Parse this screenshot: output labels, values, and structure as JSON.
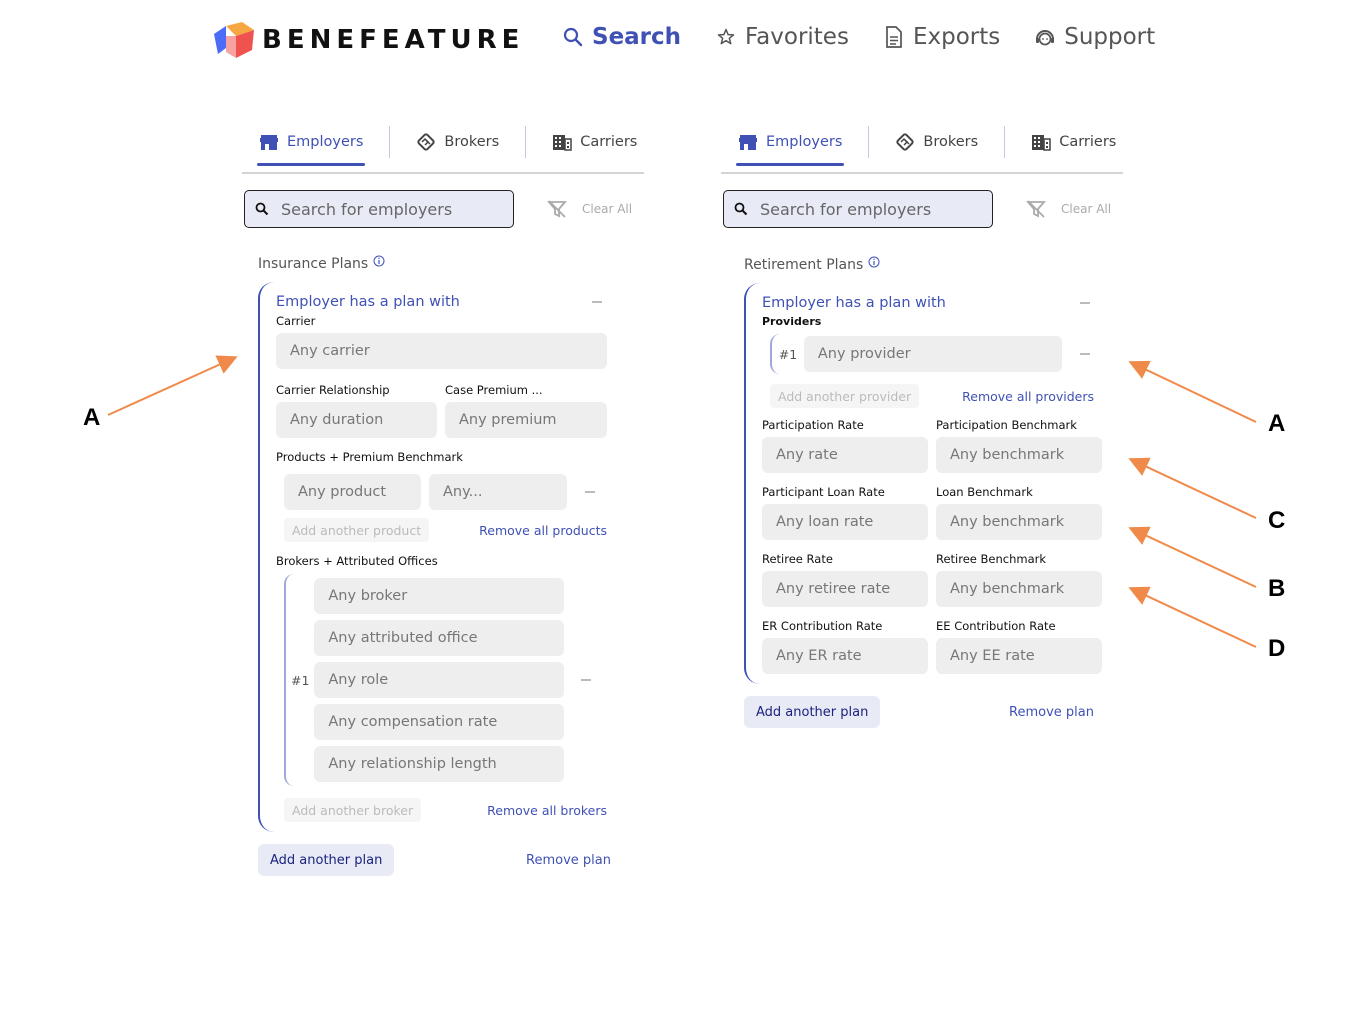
{
  "header": {
    "brand": "BENEFEATURE",
    "nav": [
      {
        "label": "Search",
        "icon": "search-icon",
        "active": true
      },
      {
        "label": "Favorites",
        "icon": "star-icon",
        "active": false
      },
      {
        "label": "Exports",
        "icon": "document-icon",
        "active": false
      },
      {
        "label": "Support",
        "icon": "support-agent-icon",
        "active": false
      }
    ]
  },
  "colors": {
    "accent": "#3f51b5",
    "field_bg": "#eeeeee",
    "search_bg": "#e8eaf6",
    "annotation_arrow": "#f08a4b"
  },
  "left_panel": {
    "tabs": [
      {
        "label": "Employers",
        "icon": "storefront-icon",
        "active": true
      },
      {
        "label": "Brokers",
        "icon": "handshake-icon",
        "active": false
      },
      {
        "label": "Carriers",
        "icon": "building-icon",
        "active": false
      }
    ],
    "search_placeholder": "Search for employers",
    "clear_all": "Clear All",
    "section_title": "Insurance Plans",
    "plan": {
      "title": "Employer has a plan with",
      "carrier_label": "Carrier",
      "carrier_placeholder": "Any carrier",
      "carrier_relationship_label": "Carrier Relationship",
      "carrier_relationship_placeholder": "Any duration",
      "case_premium_label": "Case Premium ...",
      "case_premium_placeholder": "Any premium",
      "products_label": "Products + Premium Benchmark",
      "product_placeholder": "Any product",
      "benchmark_placeholder": "Any...",
      "add_product": "Add another product",
      "remove_products": "Remove all products",
      "brokers_label": "Brokers + Attributed Offices",
      "broker_index": "#1",
      "broker_fields": [
        "Any broker",
        "Any attributed office",
        "Any role",
        "Any compensation rate",
        "Any relationship length"
      ],
      "add_broker": "Add another broker",
      "remove_brokers": "Remove all brokers"
    },
    "add_plan": "Add another plan",
    "remove_plan": "Remove plan"
  },
  "right_panel": {
    "tabs": [
      {
        "label": "Employers",
        "icon": "storefront-icon",
        "active": true
      },
      {
        "label": "Brokers",
        "icon": "handshake-icon",
        "active": false
      },
      {
        "label": "Carriers",
        "icon": "building-icon",
        "active": false
      }
    ],
    "search_placeholder": "Search for employers",
    "clear_all": "Clear All",
    "section_title": "Retirement Plans",
    "plan": {
      "title": "Employer has a plan with",
      "providers_label": "Providers",
      "provider_index": "#1",
      "provider_placeholder": "Any provider",
      "add_provider": "Add another provider",
      "remove_providers": "Remove all providers",
      "rows": [
        {
          "left_label": "Participation Rate",
          "left_placeholder": "Any rate",
          "right_label": "Participation Benchmark",
          "right_placeholder": "Any benchmark"
        },
        {
          "left_label": "Participant Loan Rate",
          "left_placeholder": "Any loan rate",
          "right_label": "Loan Benchmark",
          "right_placeholder": "Any benchmark"
        },
        {
          "left_label": "Retiree Rate",
          "left_placeholder": "Any retiree rate",
          "right_label": "Retiree Benchmark",
          "right_placeholder": "Any benchmark"
        },
        {
          "left_label": "ER Contribution Rate",
          "left_placeholder": "Any ER rate",
          "right_label": "EE Contribution Rate",
          "right_placeholder": "Any EE rate"
        }
      ]
    },
    "add_plan": "Add another plan",
    "remove_plan": "Remove plan"
  },
  "annotations": {
    "left": [
      "A"
    ],
    "right": [
      "A",
      "C",
      "B",
      "D"
    ]
  }
}
